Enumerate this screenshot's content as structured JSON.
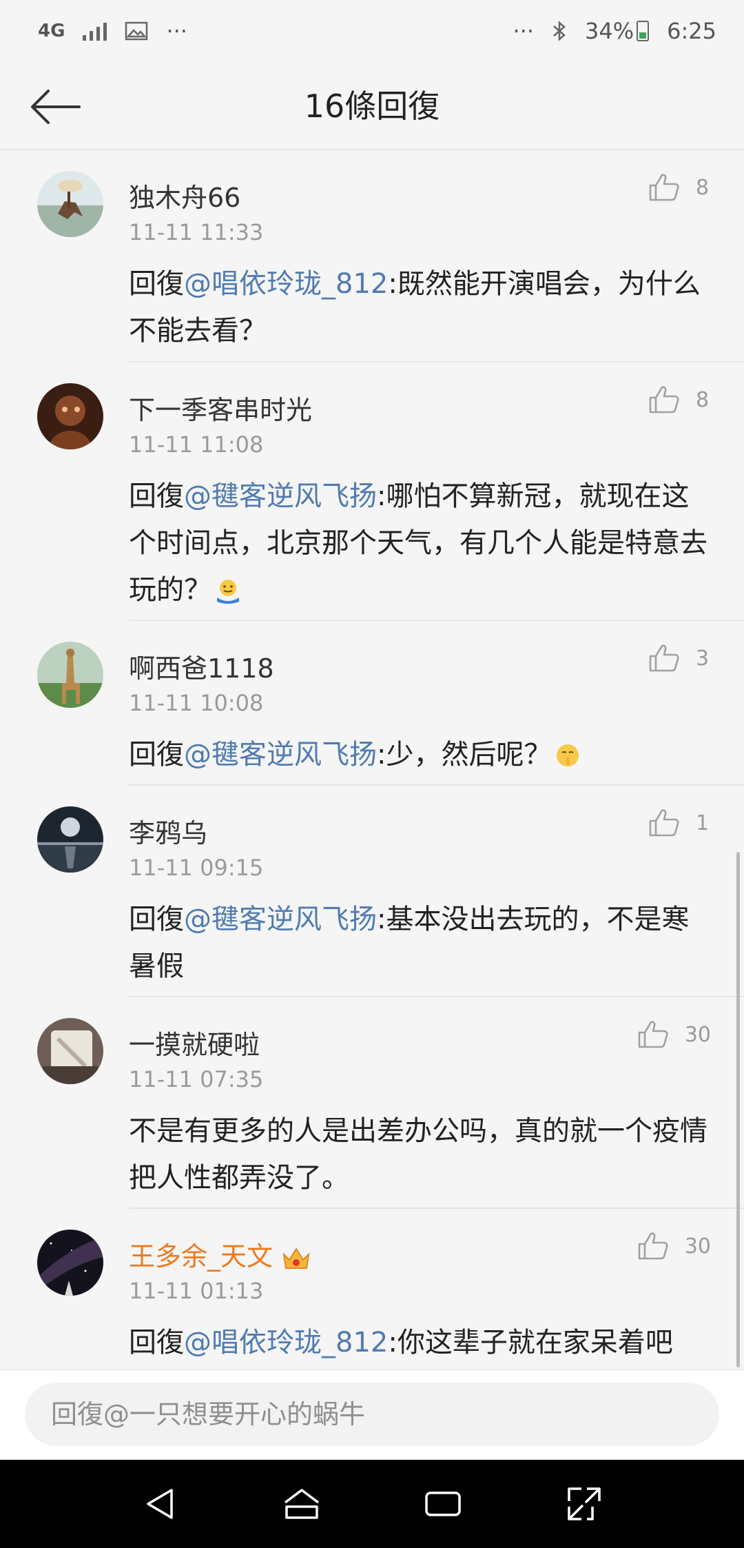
{
  "status_bar": {
    "network": "4G",
    "dots_left": "···",
    "dots_right": "···",
    "battery": "34%",
    "time": "6:25"
  },
  "header": {
    "title": "16條回復"
  },
  "comments": [
    {
      "name": "独木舟66",
      "time": "11-11 11:33",
      "likes": "8",
      "reply_prefix": "回復",
      "mention": "@唱依玲珑_812",
      "text": ":既然能开演唱会，为什么不能去看？"
    },
    {
      "name": "下一季客串时光",
      "time": "11-11 11:08",
      "likes": "8",
      "reply_prefix": "回復",
      "mention": "@毽客逆风飞扬",
      "text": ":哪怕不算新冠，就现在这个时间点，北京那个天气，有几个人能是特意去玩的？"
    },
    {
      "name": "啊西爸1118",
      "time": "11-11 10:08",
      "likes": "3",
      "reply_prefix": "回復",
      "mention": "@毽客逆风飞扬",
      "text": ":少，然后呢？"
    },
    {
      "name": "李鸦乌",
      "time": "11-11 09:15",
      "likes": "1",
      "reply_prefix": "回復",
      "mention": "@毽客逆风飞扬",
      "text": ":基本没出去玩的，不是寒暑假"
    },
    {
      "name": "一摸就硬啦",
      "time": "11-11 07:35",
      "likes": "30",
      "reply_prefix": "",
      "mention": "",
      "text": "不是有更多的人是出差办公吗，真的就一个疫情把人性都弄没了。"
    },
    {
      "name": "王多余_天文",
      "time": "11-11 01:13",
      "likes": "30",
      "reply_prefix": "回復",
      "mention": "@唱依玲珑_812",
      "text": ":你这辈子就在家呆着吧"
    }
  ],
  "reply_input": {
    "placeholder": "回復@一只想要开心的蜗牛"
  },
  "colors": {
    "mention": "#4f7bb0",
    "vip_name": "#ea7a1e",
    "background": "#f5f5f5"
  }
}
